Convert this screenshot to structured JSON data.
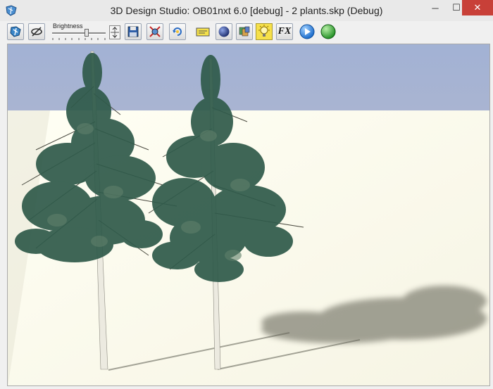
{
  "window": {
    "title": "3D Design Studio: OB01nxt 6.0 [debug] - 2 plants.skp (Debug)",
    "minimize_glyph": "─",
    "maximize_glyph": "☐",
    "close_glyph": "✕"
  },
  "toolbar": {
    "brightness_label": "Brightness",
    "brightness_level": 0.65,
    "fx_label": "FX",
    "buttons": [
      {
        "icon": "walk-icon"
      },
      {
        "icon": "orbit-icon"
      },
      {
        "icon": "save-icon"
      },
      {
        "icon": "zoom-extents-icon"
      },
      {
        "icon": "rotate-view-icon"
      },
      {
        "icon": "license-icon"
      },
      {
        "icon": "sphere-icon"
      },
      {
        "icon": "materials-icon"
      },
      {
        "icon": "light-bulb-icon"
      },
      {
        "icon": "fx-icon"
      },
      {
        "icon": "play-icon"
      },
      {
        "icon": "green-ball-icon"
      }
    ]
  },
  "colors": {
    "sky_top": "#a2b2d4",
    "sky_bottom": "#cbb9c8",
    "ground": "#fffff0",
    "foliage": "#2f5a4a",
    "close_button": "#c84038"
  }
}
